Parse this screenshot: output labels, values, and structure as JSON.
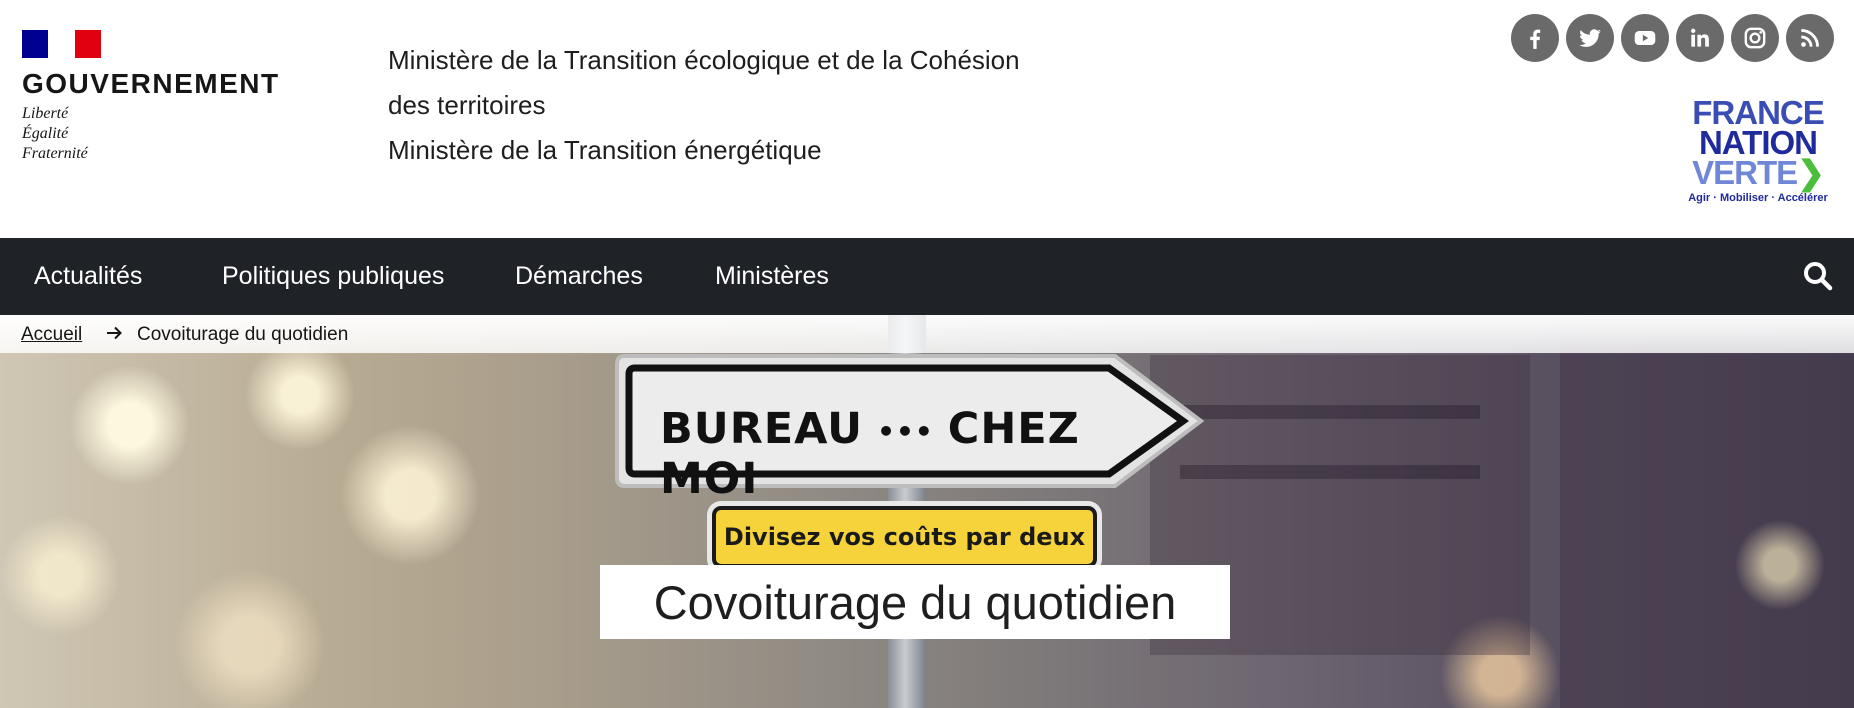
{
  "header": {
    "gov_name": "GOUVERNEMENT",
    "motto": [
      "Liberté",
      "Égalité",
      "Fraternité"
    ],
    "ministry_lines": [
      "Ministère de la Transition écologique et de la Cohésion des territoires",
      "Ministère de la Transition énergétique"
    ],
    "socials": [
      "facebook-icon",
      "twitter-icon",
      "youtube-icon",
      "linkedin-icon",
      "instagram-icon",
      "rss-icon"
    ],
    "france_nation_verte": {
      "line1": "FRANCE",
      "line2": "NATION",
      "line3": "VERTE",
      "tagline": "Agir · Mobiliser · Accélérer"
    }
  },
  "nav": {
    "items": [
      "Actualités",
      "Politiques publiques",
      "Démarches",
      "Ministères"
    ],
    "search_icon": "search-icon"
  },
  "breadcrumb": {
    "home": "Accueil",
    "current": "Covoiturage du quotidien"
  },
  "hero": {
    "sign_left": "BUREAU",
    "sign_right": "CHEZ MOI",
    "badge": "Divisez vos coûts par deux",
    "title": "Covoiturage du quotidien"
  },
  "colors": {
    "nav_bg": "#1f2328",
    "flag_blue": "#000091",
    "flag_red": "#e1000f",
    "badge_yellow": "#f6d33a",
    "social_grey": "#6a6a6a"
  }
}
